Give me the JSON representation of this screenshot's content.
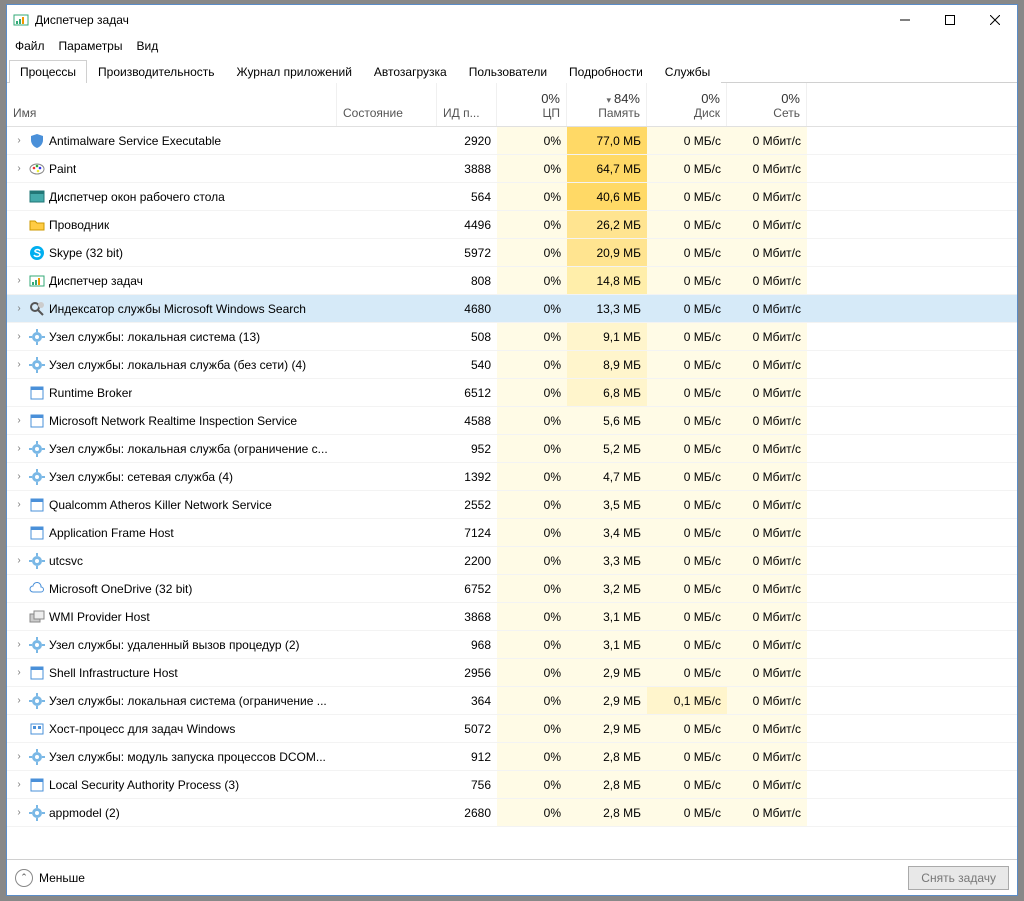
{
  "window": {
    "title": "Диспетчер задач"
  },
  "menu": {
    "file": "Файл",
    "options": "Параметры",
    "view": "Вид"
  },
  "tabs": [
    {
      "label": "Процессы",
      "active": true
    },
    {
      "label": "Производительность",
      "active": false
    },
    {
      "label": "Журнал приложений",
      "active": false
    },
    {
      "label": "Автозагрузка",
      "active": false
    },
    {
      "label": "Пользователи",
      "active": false
    },
    {
      "label": "Подробности",
      "active": false
    },
    {
      "label": "Службы",
      "active": false
    }
  ],
  "columns": {
    "name": "Имя",
    "status": "Состояние",
    "pid": "ИД п...",
    "cpu_pct": "0%",
    "cpu": "ЦП",
    "mem_pct": "84%",
    "mem": "Память",
    "disk_pct": "0%",
    "disk": "Диск",
    "net_pct": "0%",
    "net": "Сеть"
  },
  "processes": [
    {
      "expand": true,
      "icon": "shield",
      "name": "Antimalware Service Executable",
      "pid": "2920",
      "cpu": "0%",
      "mem": "77,0 МБ",
      "mem_heat": "dark",
      "disk": "0 МБ/с",
      "net": "0 Мбит/с",
      "selected": false
    },
    {
      "expand": true,
      "icon": "paint",
      "name": "Paint",
      "pid": "3888",
      "cpu": "0%",
      "mem": "64,7 МБ",
      "mem_heat": "dark",
      "disk": "0 МБ/с",
      "net": "0 Мбит/с",
      "selected": false
    },
    {
      "expand": false,
      "icon": "window",
      "name": "Диспетчер окон рабочего стола",
      "pid": "564",
      "cpu": "0%",
      "mem": "40,6 МБ",
      "mem_heat": "dark",
      "disk": "0 МБ/с",
      "net": "0 Мбит/с",
      "selected": false
    },
    {
      "expand": false,
      "icon": "folder",
      "name": "Проводник",
      "pid": "4496",
      "cpu": "0%",
      "mem": "26,2 МБ",
      "mem_heat": "vhigh",
      "disk": "0 МБ/с",
      "net": "0 Мбит/с",
      "selected": false
    },
    {
      "expand": false,
      "icon": "skype",
      "name": "Skype (32 bit)",
      "pid": "5972",
      "cpu": "0%",
      "mem": "20,9 МБ",
      "mem_heat": "vhigh",
      "disk": "0 МБ/с",
      "net": "0 Мбит/с",
      "selected": false
    },
    {
      "expand": true,
      "icon": "taskmgr",
      "name": "Диспетчер задач",
      "pid": "808",
      "cpu": "0%",
      "mem": "14,8 МБ",
      "mem_heat": "high",
      "disk": "0 МБ/с",
      "net": "0 Мбит/с",
      "selected": false
    },
    {
      "expand": true,
      "icon": "search",
      "name": "Индексатор службы Microsoft Windows Search",
      "pid": "4680",
      "cpu": "0%",
      "mem": "13,3 МБ",
      "mem_heat": "high",
      "disk": "0 МБ/с",
      "net": "0 Мбит/с",
      "selected": true
    },
    {
      "expand": true,
      "icon": "gear",
      "name": "Узел службы: локальная система (13)",
      "pid": "508",
      "cpu": "0%",
      "mem": "9,1 МБ",
      "mem_heat": "med",
      "disk": "0 МБ/с",
      "net": "0 Мбит/с",
      "selected": false
    },
    {
      "expand": true,
      "icon": "gear",
      "name": "Узел службы: локальная служба (без сети) (4)",
      "pid": "540",
      "cpu": "0%",
      "mem": "8,9 МБ",
      "mem_heat": "med",
      "disk": "0 МБ/с",
      "net": "0 Мбит/с",
      "selected": false
    },
    {
      "expand": false,
      "icon": "app",
      "name": "Runtime Broker",
      "pid": "6512",
      "cpu": "0%",
      "mem": "6,8 МБ",
      "mem_heat": "med",
      "disk": "0 МБ/с",
      "net": "0 Мбит/с",
      "selected": false
    },
    {
      "expand": true,
      "icon": "app",
      "name": "Microsoft Network Realtime Inspection Service",
      "pid": "4588",
      "cpu": "0%",
      "mem": "5,6 МБ",
      "mem_heat": "low",
      "disk": "0 МБ/с",
      "net": "0 Мбит/с",
      "selected": false
    },
    {
      "expand": true,
      "icon": "gear",
      "name": "Узел службы: локальная служба (ограничение с...",
      "pid": "952",
      "cpu": "0%",
      "mem": "5,2 МБ",
      "mem_heat": "low",
      "disk": "0 МБ/с",
      "net": "0 Мбит/с",
      "selected": false
    },
    {
      "expand": true,
      "icon": "gear",
      "name": "Узел службы: сетевая служба (4)",
      "pid": "1392",
      "cpu": "0%",
      "mem": "4,7 МБ",
      "mem_heat": "low",
      "disk": "0 МБ/с",
      "net": "0 Мбит/с",
      "selected": false
    },
    {
      "expand": true,
      "icon": "app",
      "name": "Qualcomm Atheros Killer Network Service",
      "pid": "2552",
      "cpu": "0%",
      "mem": "3,5 МБ",
      "mem_heat": "low",
      "disk": "0 МБ/с",
      "net": "0 Мбит/с",
      "selected": false
    },
    {
      "expand": false,
      "icon": "app",
      "name": "Application Frame Host",
      "pid": "7124",
      "cpu": "0%",
      "mem": "3,4 МБ",
      "mem_heat": "low",
      "disk": "0 МБ/с",
      "net": "0 Мбит/с",
      "selected": false
    },
    {
      "expand": true,
      "icon": "gear",
      "name": "utcsvc",
      "pid": "2200",
      "cpu": "0%",
      "mem": "3,3 МБ",
      "mem_heat": "low",
      "disk": "0 МБ/с",
      "net": "0 Мбит/с",
      "selected": false
    },
    {
      "expand": false,
      "icon": "cloud",
      "name": "Microsoft OneDrive (32 bit)",
      "pid": "6752",
      "cpu": "0%",
      "mem": "3,2 МБ",
      "mem_heat": "low",
      "disk": "0 МБ/с",
      "net": "0 Мбит/с",
      "selected": false
    },
    {
      "expand": false,
      "icon": "wmi",
      "name": "WMI Provider Host",
      "pid": "3868",
      "cpu": "0%",
      "mem": "3,1 МБ",
      "mem_heat": "low",
      "disk": "0 МБ/с",
      "net": "0 Мбит/с",
      "selected": false
    },
    {
      "expand": true,
      "icon": "gear",
      "name": "Узел службы: удаленный вызов процедур (2)",
      "pid": "968",
      "cpu": "0%",
      "mem": "3,1 МБ",
      "mem_heat": "low",
      "disk": "0 МБ/с",
      "net": "0 Мбит/с",
      "selected": false
    },
    {
      "expand": true,
      "icon": "app",
      "name": "Shell Infrastructure Host",
      "pid": "2956",
      "cpu": "0%",
      "mem": "2,9 МБ",
      "mem_heat": "low",
      "disk": "0 МБ/с",
      "net": "0 Мбит/с",
      "selected": false
    },
    {
      "expand": true,
      "icon": "gear",
      "name": "Узел службы: локальная система (ограничение ...",
      "pid": "364",
      "cpu": "0%",
      "mem": "2,9 МБ",
      "mem_heat": "low",
      "disk": "0,1 МБ/с",
      "disk_heat": "med",
      "net": "0 Мбит/с",
      "selected": false
    },
    {
      "expand": false,
      "icon": "host",
      "name": "Хост-процесс для задач Windows",
      "pid": "5072",
      "cpu": "0%",
      "mem": "2,9 МБ",
      "mem_heat": "low",
      "disk": "0 МБ/с",
      "net": "0 Мбит/с",
      "selected": false
    },
    {
      "expand": true,
      "icon": "gear",
      "name": "Узел службы: модуль запуска процессов DCOM...",
      "pid": "912",
      "cpu": "0%",
      "mem": "2,8 МБ",
      "mem_heat": "low",
      "disk": "0 МБ/с",
      "net": "0 Мбит/с",
      "selected": false
    },
    {
      "expand": true,
      "icon": "app",
      "name": "Local Security Authority Process (3)",
      "pid": "756",
      "cpu": "0%",
      "mem": "2,8 МБ",
      "mem_heat": "low",
      "disk": "0 МБ/с",
      "net": "0 Мбит/с",
      "selected": false
    },
    {
      "expand": true,
      "icon": "gear",
      "name": "appmodel (2)",
      "pid": "2680",
      "cpu": "0%",
      "mem": "2,8 МБ",
      "mem_heat": "low",
      "disk": "0 МБ/с",
      "net": "0 Мбит/с",
      "selected": false
    }
  ],
  "footer": {
    "fewer": "Меньше",
    "endtask": "Снять задачу"
  }
}
